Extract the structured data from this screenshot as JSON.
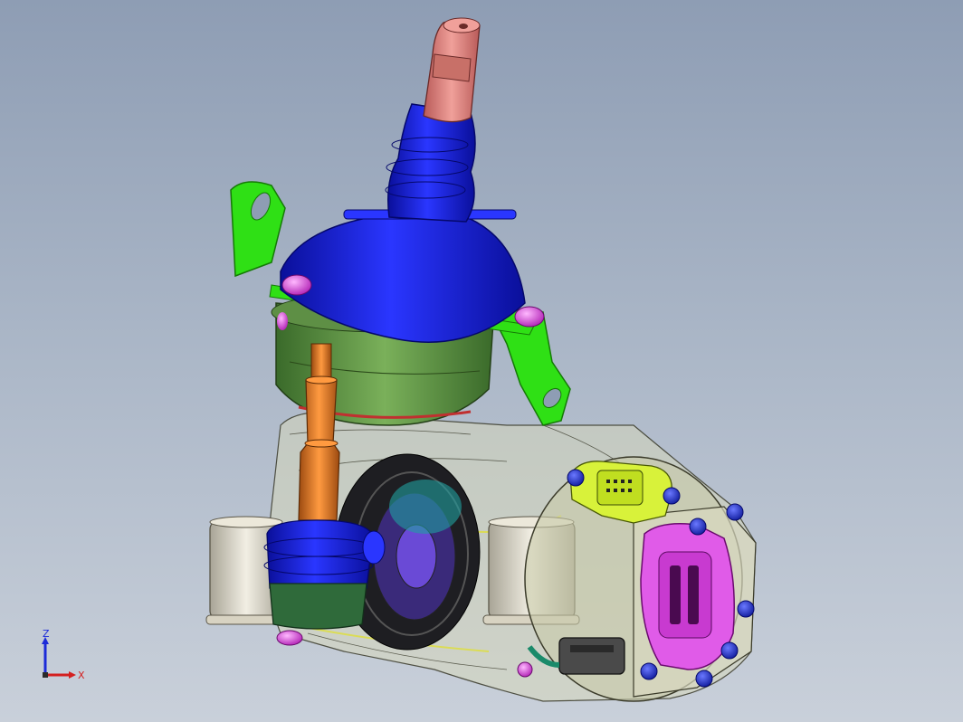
{
  "viewport": {
    "background_top": "#8e9db4",
    "background_bottom": "#c9d0da"
  },
  "model": {
    "colors": {
      "shaft_top": "#d9807a",
      "boot_blue": "#1a1fd6",
      "bracket_green": "#2fe015",
      "housing_green": "#4f8a3c",
      "housing_translucent": "#d8d9b6",
      "shaft_orange": "#e0782a",
      "bolt_magenta": "#d23fd6",
      "bolt_blue": "#2233d0",
      "connector_yellow": "#d8f23a",
      "connector_magenta": "#e05be8",
      "bushing": "#ddd8c6",
      "seal_green": "#2f6a3a"
    }
  },
  "triad": {
    "z_label": "Z",
    "x_label": "X",
    "z_color": "#1c2bd8",
    "x_color": "#d42020"
  }
}
